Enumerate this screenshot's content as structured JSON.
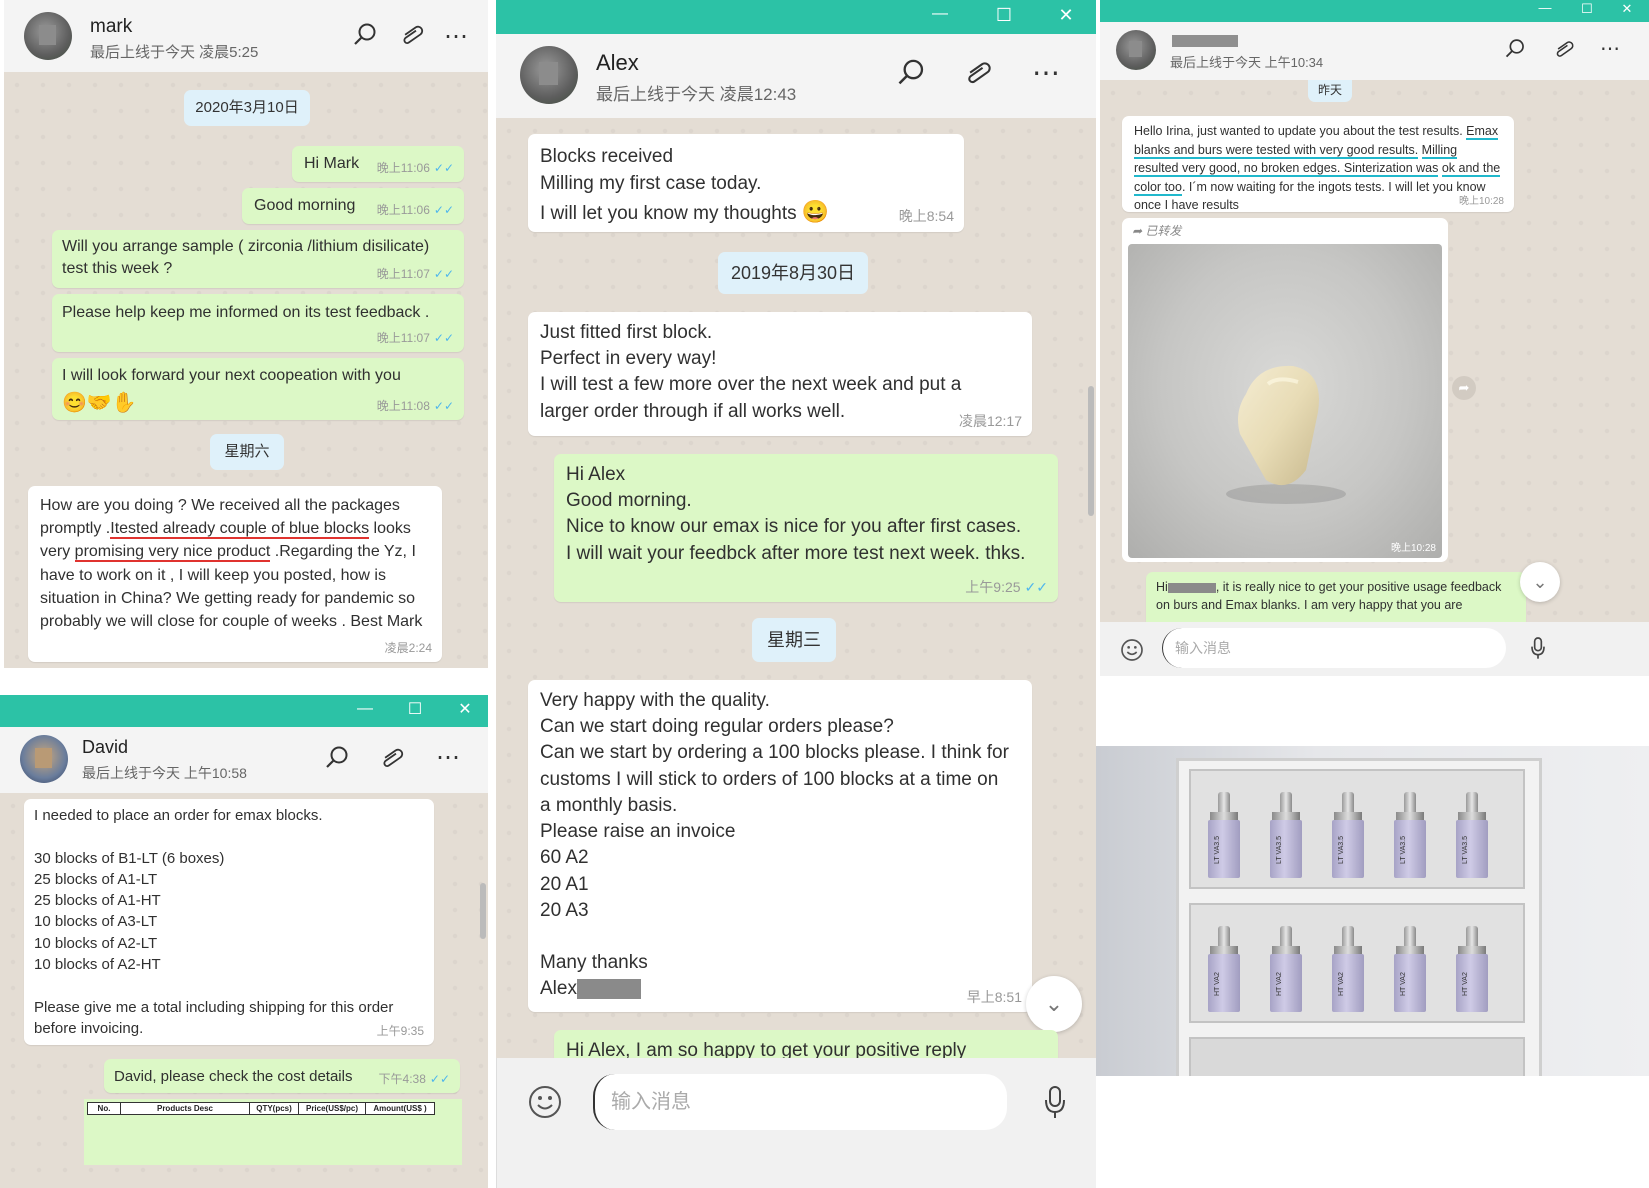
{
  "mark": {
    "name": "mark",
    "status": "最后上线于今天 凌晨5:25",
    "messages": [
      {
        "date": "2020年3月10日"
      },
      {
        "text": "Hi Mark",
        "time": "晚上11:06"
      },
      {
        "text": "Good morning",
        "time": "晚上11:06"
      },
      {
        "text": "Will you arrange sample ( zirconia /lithium disilicate)\ntest this week ?",
        "time": "晚上11:07"
      },
      {
        "text": "Please help keep me informed on its test feedback .",
        "time": "晚上11:07"
      },
      {
        "text": "I will look forward your next coopeation with you",
        "emoji": "😊🤝✋",
        "time": "晚上11:08"
      },
      {
        "date": "星期六"
      },
      {
        "parts": [
          "How are you doing ? We received all the packages promptly .",
          "Itested already couple of blue blocks",
          " looks very ",
          "promising very nice product",
          " .Regarding the Yz, I have to work on it , I will keep you posted, how is situation in China? We getting ready for pandemic so probably we will close for couple of weeks . Best Mark"
        ],
        "time": "凌晨2:24"
      }
    ]
  },
  "david": {
    "name": "David",
    "status": "最后上线于今天 上午10:58",
    "messages": [
      {
        "text": "I needed to place an order for emax blocks.\n\n30 blocks of B1-LT (6 boxes)\n25 blocks of A1-LT\n25 blocks of A1-HT\n10 blocks of A3-LT\n10 blocks of A2-LT\n10 blocks of A2-HT\n\nPlease give me a total including shipping for this order\nbefore invoicing.",
        "time": "上午9:35"
      },
      {
        "text": "David, please check the cost details",
        "time": "下午4:38"
      }
    ],
    "table_headers": [
      "No.",
      "Products Desc",
      "QTY(pcs)",
      "Price(US$/pc)",
      "Amount(US$ )"
    ]
  },
  "alex": {
    "name": "Alex",
    "status": "最后上线于今天 凌晨12:43",
    "messages": [
      {
        "text": "Blocks received\nMilling my first case today.\nI will let you know my thoughts",
        "emoji": "😀",
        "time": "晚上8:54"
      },
      {
        "date": "2019年8月30日"
      },
      {
        "text": "Just fitted first block.\nPerfect in every way!\nI will test a few more over the next week and put a\nlarger order through if all works well.",
        "time": "凌晨12:17"
      },
      {
        "text": "Hi Alex\nGood morning.\nNice to know our emax is nice for you after first cases.\nI will wait your feedbck after more test next week. thks.",
        "time": "上午9:25"
      },
      {
        "date": "星期三"
      },
      {
        "text": "Very happy with the quality.\nCan we start doing regular orders please?\nCan we start by ordering a 100 blocks please. I think for\ncustoms I will stick to orders of 100 blocks at a time on\na monthly basis.\nPlease raise an invoice\n60 A2\n20 A1\n20 A3\n\nMany thanks",
        "sign": "Alex",
        "time": "早上8:51"
      },
      {
        "text": "Hi Alex, I am so happy to get your positive reply"
      }
    ],
    "input_placeholder": "输入消息"
  },
  "irina": {
    "status": "最后上线于今天 上午10:34",
    "date_chip": "昨天",
    "message_parts": [
      "Hello Irina, just wanted to update you about the test results.",
      "Emax blanks and burs were tested with very good results.",
      "Milling resulted very good, no broken edges. Sinterization was",
      "ok and the color too",
      ". I´m now waiting for the ingots tests. I will let you know once I have results"
    ],
    "message_time": "晚上10:28",
    "forwarded_label": "已转发",
    "image_time": "晚上10:28",
    "reply_parts": [
      "Hi",
      ", it is really nice to get your positive usage feedback",
      "on burs and Emax blanks. I am very happy that you are"
    ],
    "input_placeholder": "输入消息"
  },
  "photo": {
    "top_labels": [
      "LT VA3.5",
      "LT VA3.5",
      "LT VA3.5",
      "LT VA3.5",
      "LT VA3.5"
    ],
    "bottom_labels": [
      "HT VA2",
      "HT VA2",
      "HT VA2",
      "HT VA2",
      "HT VA2"
    ]
  }
}
